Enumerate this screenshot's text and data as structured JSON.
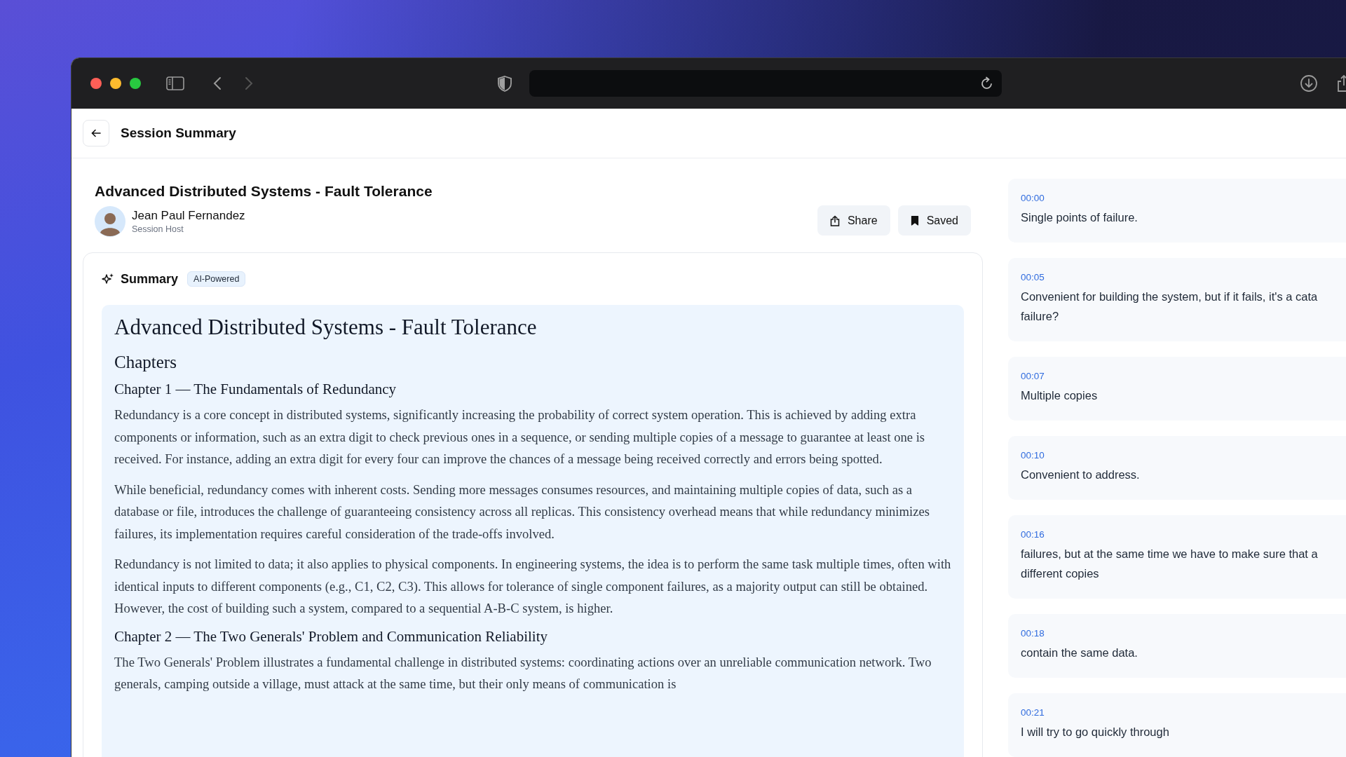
{
  "header": {
    "title": "Session Summary"
  },
  "session": {
    "title": "Advanced Distributed Systems - Fault Tolerance",
    "host": {
      "name": "Jean Paul Fernandez",
      "role": "Session Host"
    }
  },
  "actions": [
    {
      "label": "Share",
      "kind": "share"
    },
    {
      "label": "Saved",
      "kind": "saved"
    }
  ],
  "summary": {
    "title": "Summary",
    "badge": "AI-Powered",
    "document": {
      "title": "Advanced Distributed Systems - Fault Tolerance",
      "subheading": "Chapters",
      "chapters": [
        {
          "heading": "Chapter 1 — The Fundamentals of Redundancy",
          "paragraphs": [
            "Redundancy is a core concept in distributed systems, significantly increasing the probability of correct system operation. This is achieved by adding extra components or information, such as an extra digit to check previous ones in a sequence, or sending multiple copies of a message to guarantee at least one is received. For instance, adding an extra digit for every four can improve the chances of a message being received correctly and errors being spotted.",
            "While beneficial, redundancy comes with inherent costs. Sending more messages consumes resources, and maintaining multiple copies of data, such as a database or file, introduces the challenge of guaranteeing consistency across all replicas. This consistency overhead means that while redundancy minimizes failures, its implementation requires careful consideration of the trade-offs involved.",
            "Redundancy is not limited to data; it also applies to physical components. In engineering systems, the idea is to perform the same task multiple times, often with identical inputs to different components (e.g., C1, C2, C3). This allows for tolerance of single component failures, as a majority output can still be obtained. However, the cost of building such a system, compared to a sequential A-B-C system, is higher."
          ]
        },
        {
          "heading": "Chapter 2 — The Two Generals' Problem and Communication Reliability",
          "paragraphs": [
            "The Two Generals' Problem illustrates a fundamental challenge in distributed systems: coordinating actions over an unreliable communication network. Two generals, camping outside a village, must attack at the same time, but their only means of communication is"
          ]
        }
      ]
    }
  },
  "transcript": [
    {
      "time": "00:00",
      "lines": [
        "Single points of failure."
      ]
    },
    {
      "time": "00:05",
      "lines": [
        "Convenient for building the system, but if it fails, it's a cata",
        "failure?"
      ]
    },
    {
      "time": "00:07",
      "lines": [
        "Multiple copies"
      ]
    },
    {
      "time": "00:10",
      "lines": [
        "Convenient to address."
      ]
    },
    {
      "time": "00:16",
      "lines": [
        "failures, but at the same time we have to make sure that a",
        "different copies"
      ]
    },
    {
      "time": "00:18",
      "lines": [
        "contain the same data."
      ]
    },
    {
      "time": "00:21",
      "lines": [
        "I will try to go quickly through"
      ]
    }
  ]
}
